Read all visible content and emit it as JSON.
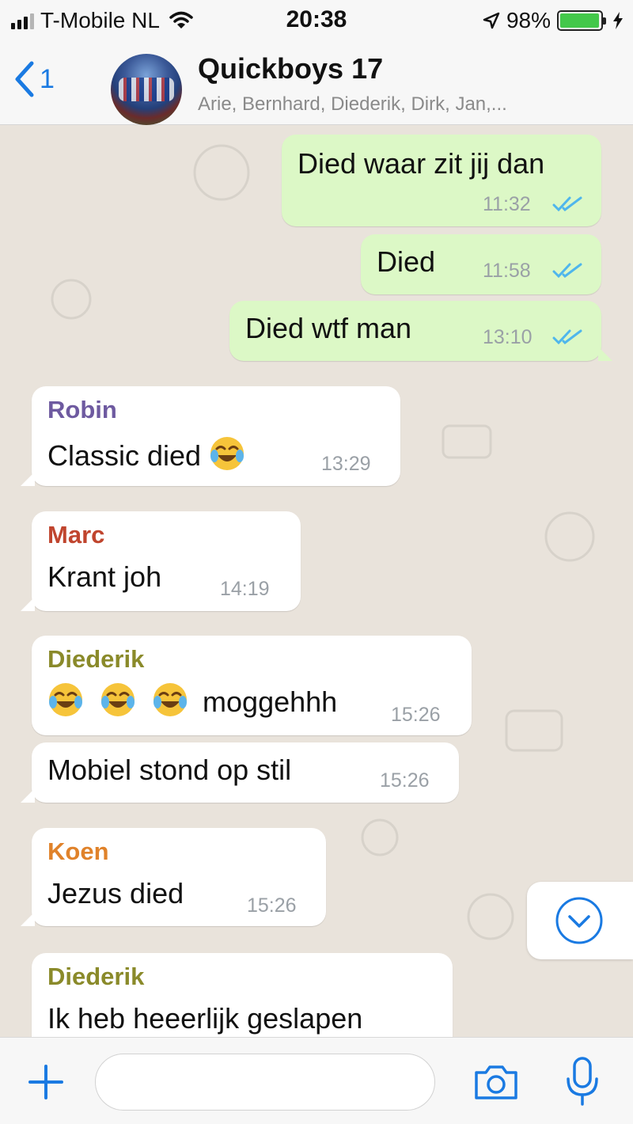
{
  "status_bar": {
    "carrier": "T-Mobile NL",
    "time": "20:38",
    "battery": "98%",
    "battery_level": 0.98
  },
  "header": {
    "back_count": "1",
    "title": "Quickboys 17",
    "subtitle": "Arie, Bernhard, Diederik, Dirk, Jan,..."
  },
  "messages": [
    {
      "text": "Died waar zit jij dan",
      "time": "11:32",
      "outgoing": true
    },
    {
      "text": "Died",
      "time": "11:58",
      "outgoing": true
    },
    {
      "text": "Died wtf man",
      "time": "13:10",
      "outgoing": true
    },
    {
      "sender": "Robin",
      "text": "Classic died",
      "emoji": "😂",
      "time": "13:29"
    },
    {
      "sender": "Marc",
      "text": "Krant joh",
      "time": "14:19"
    },
    {
      "sender": "Diederik",
      "text": "moggehhh",
      "emoji": "😂😂😂",
      "time": "15:26"
    },
    {
      "text": "Mobiel stond op stil",
      "time": "15:26"
    },
    {
      "sender": "Koen",
      "text": "Jezus died",
      "time": "15:26"
    },
    {
      "sender": "Diederik",
      "text": "Ik heb heeerlijk geslapen"
    }
  ],
  "sender_colors": {
    "Robin": "#6e5aa0",
    "Marc": "#c0452e",
    "Diederik": "#8a8a2a",
    "Koen": "#e0822a"
  },
  "colors": {
    "accent": "#1a7ae2",
    "outgoing_bubble": "#dcf8c6",
    "incoming_bubble": "#ffffff",
    "read_ticks": "#4fb6ec",
    "chat_background": "#e9e3db"
  },
  "icons": [
    "signal-icon",
    "wifi-icon",
    "location-arrow-icon",
    "battery-icon",
    "charging-icon",
    "back-chevron-icon",
    "double-check-icon",
    "emoji-tears-of-joy-icon",
    "scroll-down-chevron-icon",
    "plus-icon",
    "camera-icon",
    "microphone-icon"
  ],
  "input": {
    "placeholder": ""
  }
}
